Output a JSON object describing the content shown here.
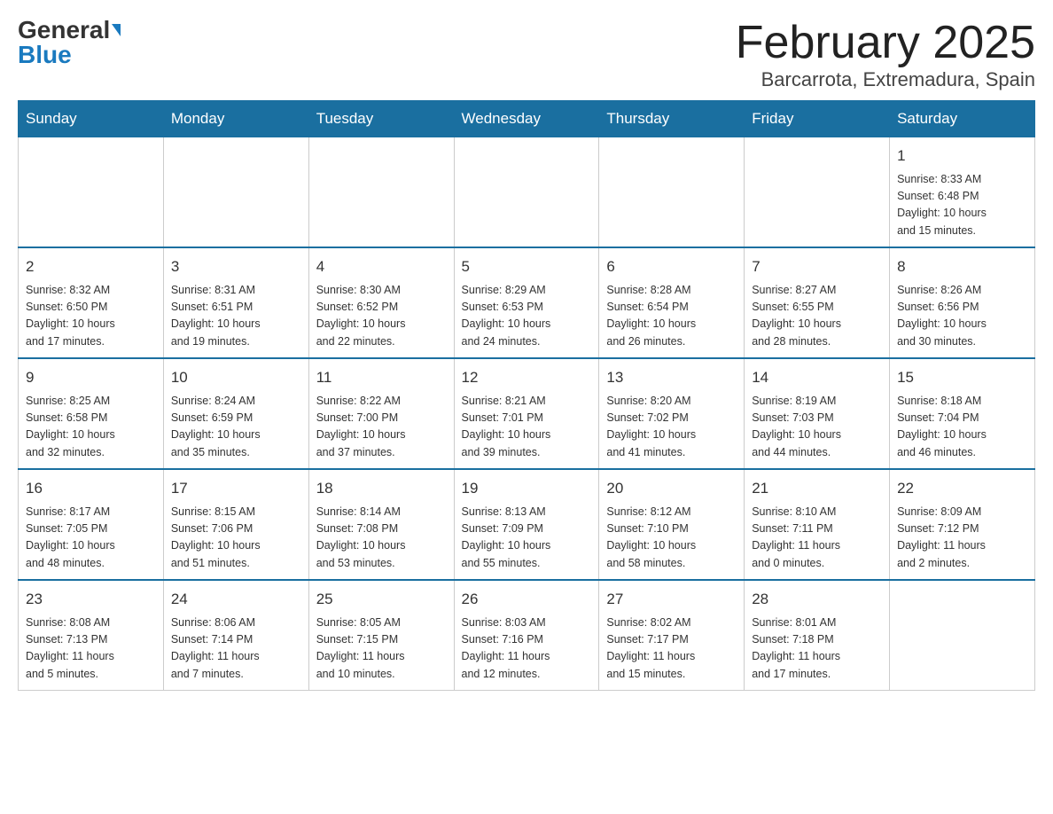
{
  "logo": {
    "general": "General",
    "blue": "Blue"
  },
  "title": "February 2025",
  "subtitle": "Barcarrota, Extremadura, Spain",
  "days_of_week": [
    "Sunday",
    "Monday",
    "Tuesday",
    "Wednesday",
    "Thursday",
    "Friday",
    "Saturday"
  ],
  "weeks": [
    [
      {
        "day": "",
        "info": ""
      },
      {
        "day": "",
        "info": ""
      },
      {
        "day": "",
        "info": ""
      },
      {
        "day": "",
        "info": ""
      },
      {
        "day": "",
        "info": ""
      },
      {
        "day": "",
        "info": ""
      },
      {
        "day": "1",
        "info": "Sunrise: 8:33 AM\nSunset: 6:48 PM\nDaylight: 10 hours\nand 15 minutes."
      }
    ],
    [
      {
        "day": "2",
        "info": "Sunrise: 8:32 AM\nSunset: 6:50 PM\nDaylight: 10 hours\nand 17 minutes."
      },
      {
        "day": "3",
        "info": "Sunrise: 8:31 AM\nSunset: 6:51 PM\nDaylight: 10 hours\nand 19 minutes."
      },
      {
        "day": "4",
        "info": "Sunrise: 8:30 AM\nSunset: 6:52 PM\nDaylight: 10 hours\nand 22 minutes."
      },
      {
        "day": "5",
        "info": "Sunrise: 8:29 AM\nSunset: 6:53 PM\nDaylight: 10 hours\nand 24 minutes."
      },
      {
        "day": "6",
        "info": "Sunrise: 8:28 AM\nSunset: 6:54 PM\nDaylight: 10 hours\nand 26 minutes."
      },
      {
        "day": "7",
        "info": "Sunrise: 8:27 AM\nSunset: 6:55 PM\nDaylight: 10 hours\nand 28 minutes."
      },
      {
        "day": "8",
        "info": "Sunrise: 8:26 AM\nSunset: 6:56 PM\nDaylight: 10 hours\nand 30 minutes."
      }
    ],
    [
      {
        "day": "9",
        "info": "Sunrise: 8:25 AM\nSunset: 6:58 PM\nDaylight: 10 hours\nand 32 minutes."
      },
      {
        "day": "10",
        "info": "Sunrise: 8:24 AM\nSunset: 6:59 PM\nDaylight: 10 hours\nand 35 minutes."
      },
      {
        "day": "11",
        "info": "Sunrise: 8:22 AM\nSunset: 7:00 PM\nDaylight: 10 hours\nand 37 minutes."
      },
      {
        "day": "12",
        "info": "Sunrise: 8:21 AM\nSunset: 7:01 PM\nDaylight: 10 hours\nand 39 minutes."
      },
      {
        "day": "13",
        "info": "Sunrise: 8:20 AM\nSunset: 7:02 PM\nDaylight: 10 hours\nand 41 minutes."
      },
      {
        "day": "14",
        "info": "Sunrise: 8:19 AM\nSunset: 7:03 PM\nDaylight: 10 hours\nand 44 minutes."
      },
      {
        "day": "15",
        "info": "Sunrise: 8:18 AM\nSunset: 7:04 PM\nDaylight: 10 hours\nand 46 minutes."
      }
    ],
    [
      {
        "day": "16",
        "info": "Sunrise: 8:17 AM\nSunset: 7:05 PM\nDaylight: 10 hours\nand 48 minutes."
      },
      {
        "day": "17",
        "info": "Sunrise: 8:15 AM\nSunset: 7:06 PM\nDaylight: 10 hours\nand 51 minutes."
      },
      {
        "day": "18",
        "info": "Sunrise: 8:14 AM\nSunset: 7:08 PM\nDaylight: 10 hours\nand 53 minutes."
      },
      {
        "day": "19",
        "info": "Sunrise: 8:13 AM\nSunset: 7:09 PM\nDaylight: 10 hours\nand 55 minutes."
      },
      {
        "day": "20",
        "info": "Sunrise: 8:12 AM\nSunset: 7:10 PM\nDaylight: 10 hours\nand 58 minutes."
      },
      {
        "day": "21",
        "info": "Sunrise: 8:10 AM\nSunset: 7:11 PM\nDaylight: 11 hours\nand 0 minutes."
      },
      {
        "day": "22",
        "info": "Sunrise: 8:09 AM\nSunset: 7:12 PM\nDaylight: 11 hours\nand 2 minutes."
      }
    ],
    [
      {
        "day": "23",
        "info": "Sunrise: 8:08 AM\nSunset: 7:13 PM\nDaylight: 11 hours\nand 5 minutes."
      },
      {
        "day": "24",
        "info": "Sunrise: 8:06 AM\nSunset: 7:14 PM\nDaylight: 11 hours\nand 7 minutes."
      },
      {
        "day": "25",
        "info": "Sunrise: 8:05 AM\nSunset: 7:15 PM\nDaylight: 11 hours\nand 10 minutes."
      },
      {
        "day": "26",
        "info": "Sunrise: 8:03 AM\nSunset: 7:16 PM\nDaylight: 11 hours\nand 12 minutes."
      },
      {
        "day": "27",
        "info": "Sunrise: 8:02 AM\nSunset: 7:17 PM\nDaylight: 11 hours\nand 15 minutes."
      },
      {
        "day": "28",
        "info": "Sunrise: 8:01 AM\nSunset: 7:18 PM\nDaylight: 11 hours\nand 17 minutes."
      },
      {
        "day": "",
        "info": ""
      }
    ]
  ]
}
